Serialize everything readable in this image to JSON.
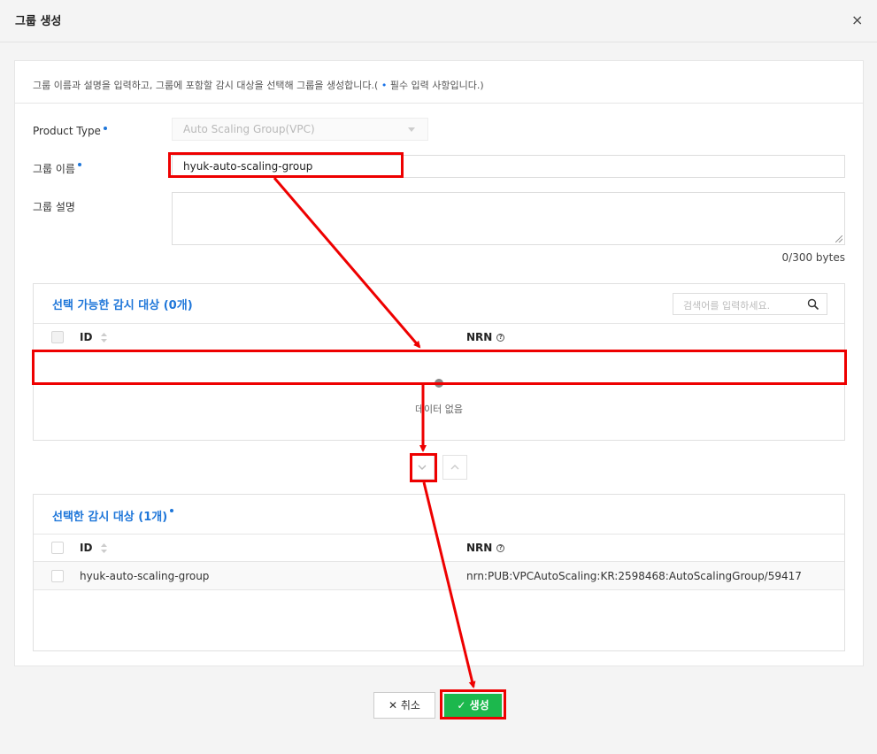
{
  "header": {
    "title": "그룹 생성",
    "close": "×"
  },
  "form": {
    "description_before": "그룹 이름과 설명을 입력하고, 그룹에 포함할 감시 대상을 선택해 그룹을 생성합니다.( ",
    "description_dot": "•",
    "description_after": " 필수 입력 사항입니다.)",
    "product_type_label": "Product Type",
    "product_type_value": "Auto Scaling Group(VPC)",
    "group_name_label": "그룹 이름",
    "group_name_value": "hyuk-auto-scaling-group",
    "group_desc_label": "그룹 설명",
    "byte_counter": "0/300 bytes"
  },
  "available": {
    "title": "선택 가능한 감시 대상 (0개)",
    "search_placeholder": "검색어를 입력하세요.",
    "col_id": "ID",
    "col_nrn": "NRN",
    "empty_text": "데이터 없음"
  },
  "selected": {
    "title": "선택한 감시 대상 (1개)",
    "col_id": "ID",
    "col_nrn": "NRN",
    "rows": [
      {
        "id": "hyuk-auto-scaling-group",
        "nrn": "nrn:PUB:VPCAutoScaling:KR:2598468:AutoScalingGroup/59417"
      }
    ]
  },
  "footer": {
    "cancel_label": "취소",
    "create_label": "생성"
  },
  "colors": {
    "accent": "#1e76d9",
    "create": "#1cb84d",
    "highlight": "#ee0000"
  }
}
